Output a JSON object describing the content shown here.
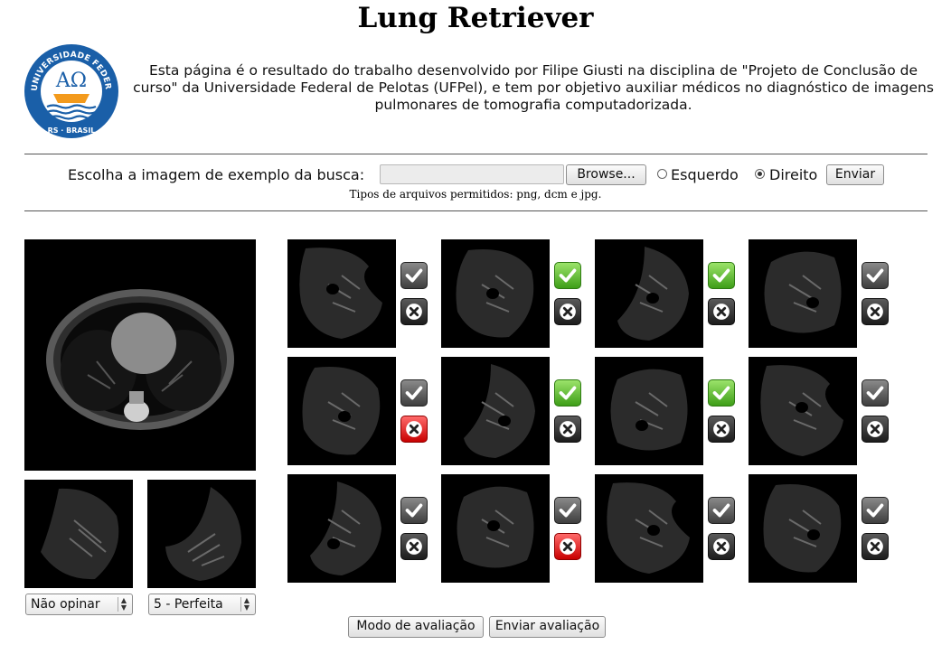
{
  "header": {
    "title": "Lung Retriever",
    "intro": "Esta página é o resultado do trabalho desenvolvido por Filipe Giusti na disciplina de \"Projeto de Conclusão de curso\" da Universidade Federal de Pelotas (UFPel), e tem por objetivo auxiliar médicos no diagnóstico de imagens pulmonares de tomografia computadorizada.",
    "logo": {
      "ring_text": "UNIVERSIDADE FEDERAL DE PELOTAS",
      "bottom_text": "RS · BRASIL",
      "symbol": "AΩ",
      "colors": {
        "blue": "#1a5fa8",
        "orange": "#f39a1c"
      }
    }
  },
  "upload": {
    "label": "Escolha a imagem de exemplo da busca:",
    "file_value": "",
    "browse_label": "Browse...",
    "side_options": [
      {
        "label": "Esquerdo",
        "selected": false
      },
      {
        "label": "Direito",
        "selected": true
      }
    ],
    "send_label": "Enviar",
    "file_types": "Tipos de arquivos permitidos: png, dcm e jpg."
  },
  "query": {
    "main_image": "axial-chest-ct",
    "samples": [
      {
        "image": "left-lung-ct",
        "rating": "Não opinar"
      },
      {
        "image": "right-lung-ct",
        "rating": "5 - Perfeita"
      }
    ]
  },
  "results": {
    "rows": [
      [
        {
          "check": "gray",
          "x": "dark"
        },
        {
          "check": "green",
          "x": "dark"
        },
        {
          "check": "green",
          "x": "dark"
        },
        {
          "check": "gray",
          "x": "dark"
        }
      ],
      [
        {
          "check": "gray",
          "x": "red"
        },
        {
          "check": "green",
          "x": "dark"
        },
        {
          "check": "green",
          "x": "dark"
        },
        {
          "check": "gray",
          "x": "dark"
        }
      ],
      [
        {
          "check": "gray",
          "x": "dark"
        },
        {
          "check": "gray",
          "x": "red"
        },
        {
          "check": "gray",
          "x": "dark"
        },
        {
          "check": "gray",
          "x": "dark"
        }
      ]
    ]
  },
  "footer": {
    "mode_label": "Modo de avaliação",
    "submit_label": "Enviar avaliação"
  },
  "colors": {
    "accent_green": "#4caf1c",
    "reject_red": "#e01010",
    "ct_background": "#000000"
  }
}
